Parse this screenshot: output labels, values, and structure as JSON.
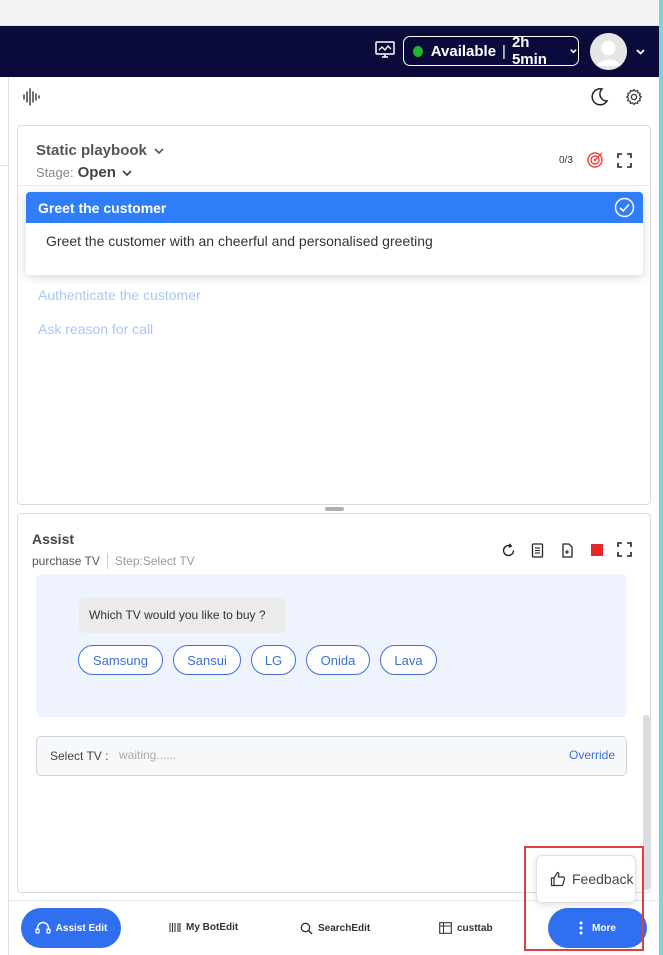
{
  "navbar": {
    "status_label": "Available",
    "status_time": "2h 5min",
    "status_color": "#1fb72a",
    "icons": [
      "monitor-icon",
      "avatar",
      "chevron-down-icon"
    ]
  },
  "toolbar": {
    "icons": [
      "waveform-icon",
      "moon-icon",
      "gear-icon"
    ]
  },
  "playbook": {
    "title": "Static playbook",
    "stage_label": "Stage:",
    "stage_value": "Open",
    "count": "0/3",
    "steps": [
      {
        "title": "Greet the customer",
        "description": "Greet the customer with an cheerful and personalised greeting",
        "active": true
      },
      {
        "title": "Authenticate the customer",
        "active": false
      },
      {
        "title": "Ask reason for call",
        "active": false
      }
    ]
  },
  "assist": {
    "title": "Assist",
    "flow": "purchase TV",
    "step": "Step:Select TV",
    "question": "Which TV would you like to buy ?",
    "options": [
      "Samsung",
      "Sansui",
      "LG",
      "Onida",
      "Lava"
    ],
    "field_label": "Select TV :",
    "field_value": "waiting......",
    "override_label": "Override"
  },
  "bottom_nav": {
    "assist_edit": "Assist Edit",
    "my_bot_edit": "My BotEdit",
    "search_edit": "SearchEdit",
    "custtab": "custtab",
    "more": "More"
  },
  "feedback": {
    "label": "Feedback"
  },
  "colors": {
    "navbar_bg": "#0b0b3b",
    "accent": "#2f7ef7",
    "stop": "#e8262a",
    "highlight": "#e33e3e"
  }
}
